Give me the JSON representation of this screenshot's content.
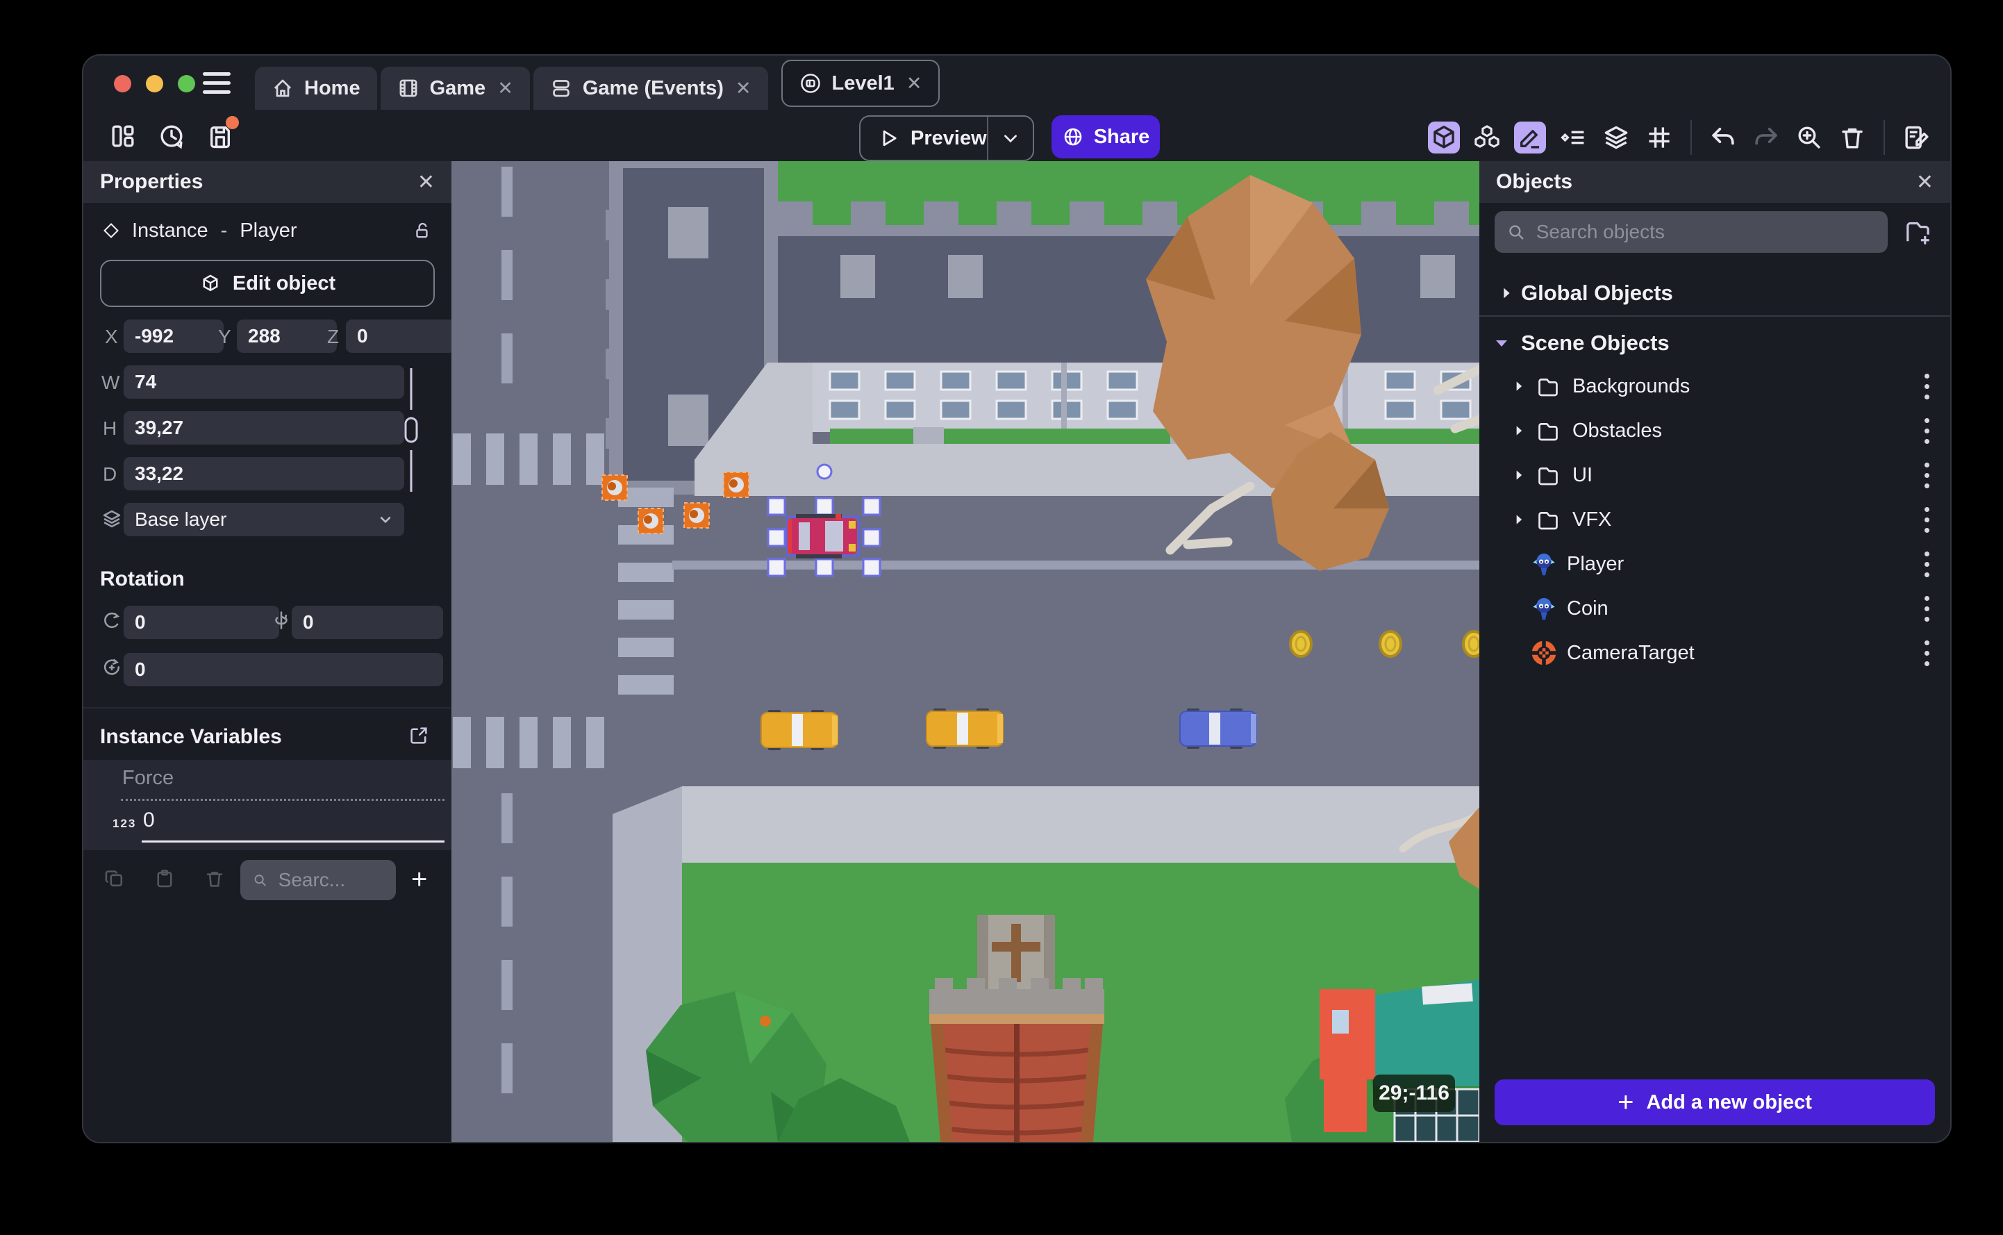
{
  "window_controls": {
    "close_color": "#EC6A5E",
    "minimize_color": "#F5BF4F",
    "zoom_color": "#61C554"
  },
  "tabs": {
    "close_glyph": "✕",
    "items": [
      {
        "label": "Home",
        "active": false
      },
      {
        "label": "Game",
        "active": false
      },
      {
        "label": "Game (Events)",
        "active": false
      },
      {
        "label": "Level1",
        "active": true
      }
    ]
  },
  "toolbar": {
    "preview_label": "Preview",
    "share_label": "Share"
  },
  "properties_panel": {
    "title": "Properties",
    "close_glyph": "✕",
    "instance_type": "Instance",
    "separator": "-",
    "object_name": "Player",
    "edit_object_label": "Edit object",
    "position": {
      "x_label": "X",
      "x_value": "-992",
      "y_label": "Y",
      "y_value": "288",
      "z_label": "Z",
      "z_value": "0"
    },
    "size": {
      "w_label": "W",
      "w_value": "74",
      "h_label": "H",
      "h_value": "39,27",
      "d_label": "D",
      "d_value": "33,22"
    },
    "layer_value": "Base layer",
    "rotation": {
      "title": "Rotation",
      "x_value": "0",
      "y_value": "0",
      "z_value": "0"
    },
    "variables": {
      "title": "Instance Variables",
      "rows": [
        {
          "name": "Force",
          "type_badge": "123",
          "value": "0"
        }
      ],
      "search_placeholder": "Searc...",
      "add_glyph": "+"
    }
  },
  "objects_panel": {
    "title": "Objects",
    "close_glyph": "✕",
    "search_placeholder": "Search objects",
    "global_group_label": "Global Objects",
    "scene_group_label": "Scene Objects",
    "folders": [
      {
        "name": "Backgrounds"
      },
      {
        "name": "Obstacles"
      },
      {
        "name": "UI"
      },
      {
        "name": "VFX"
      }
    ],
    "objects": [
      {
        "name": "Player"
      },
      {
        "name": "Coin"
      },
      {
        "name": "CameraTarget"
      }
    ],
    "add_button_label": "Add a new object",
    "add_glyph": "+"
  },
  "scene_view": {
    "cursor_coordinates": "29;-116",
    "selected_instance": "Player"
  },
  "colors": {
    "accent_purple": "#4B22D9",
    "active_icon_bg": "#BCA9F5",
    "unsaved_dot": "#F0764F",
    "panel_bg": "#1A1C24",
    "panel_header_bg": "#2A2D36",
    "field_bg": "#31343E",
    "road": "#6C6F82",
    "grass": "#4DA14D",
    "selection_blue": "#5F63E0"
  }
}
